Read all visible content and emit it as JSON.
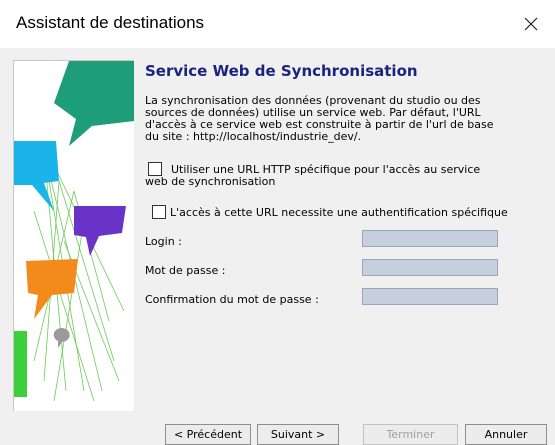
{
  "window": {
    "title": "Assistant de destinations",
    "close_icon": "close-icon"
  },
  "page": {
    "heading": "Service Web de Synchronisation",
    "description": "La synchronisation des données (provenant du studio ou des\nsources de données) utilise un service web. Par défaut, l'URL\nd'accès à ce service web est construite à partir de l'url de base\ndu site : http://localhost/industrie_dev/."
  },
  "options": {
    "specific_url": {
      "label": "Utiliser une URL HTTP spécifique pour l'accès au service\nweb de synchronisation",
      "checked": false
    },
    "auth_required": {
      "label": "L'accès à cette URL necessite une authentification spécifique",
      "checked": false
    }
  },
  "form": {
    "login_label": "Login :",
    "login_value": "",
    "password_label": "Mot de passe :",
    "password_value": "",
    "confirm_label": "Confirmation du mot de passe :",
    "confirm_value": ""
  },
  "buttons": {
    "previous": "< Précédent",
    "next": "Suivant >",
    "finish": "Terminer",
    "cancel": "Annuler"
  },
  "colors": {
    "heading": "#1a237e",
    "field_background": "#c5cfde",
    "banner_green": "#1e9e78",
    "banner_cyan": "#1ab4ea",
    "banner_purple": "#6a33c7",
    "banner_orange": "#f28a1c",
    "banner_lime": "#3ccf3c"
  }
}
